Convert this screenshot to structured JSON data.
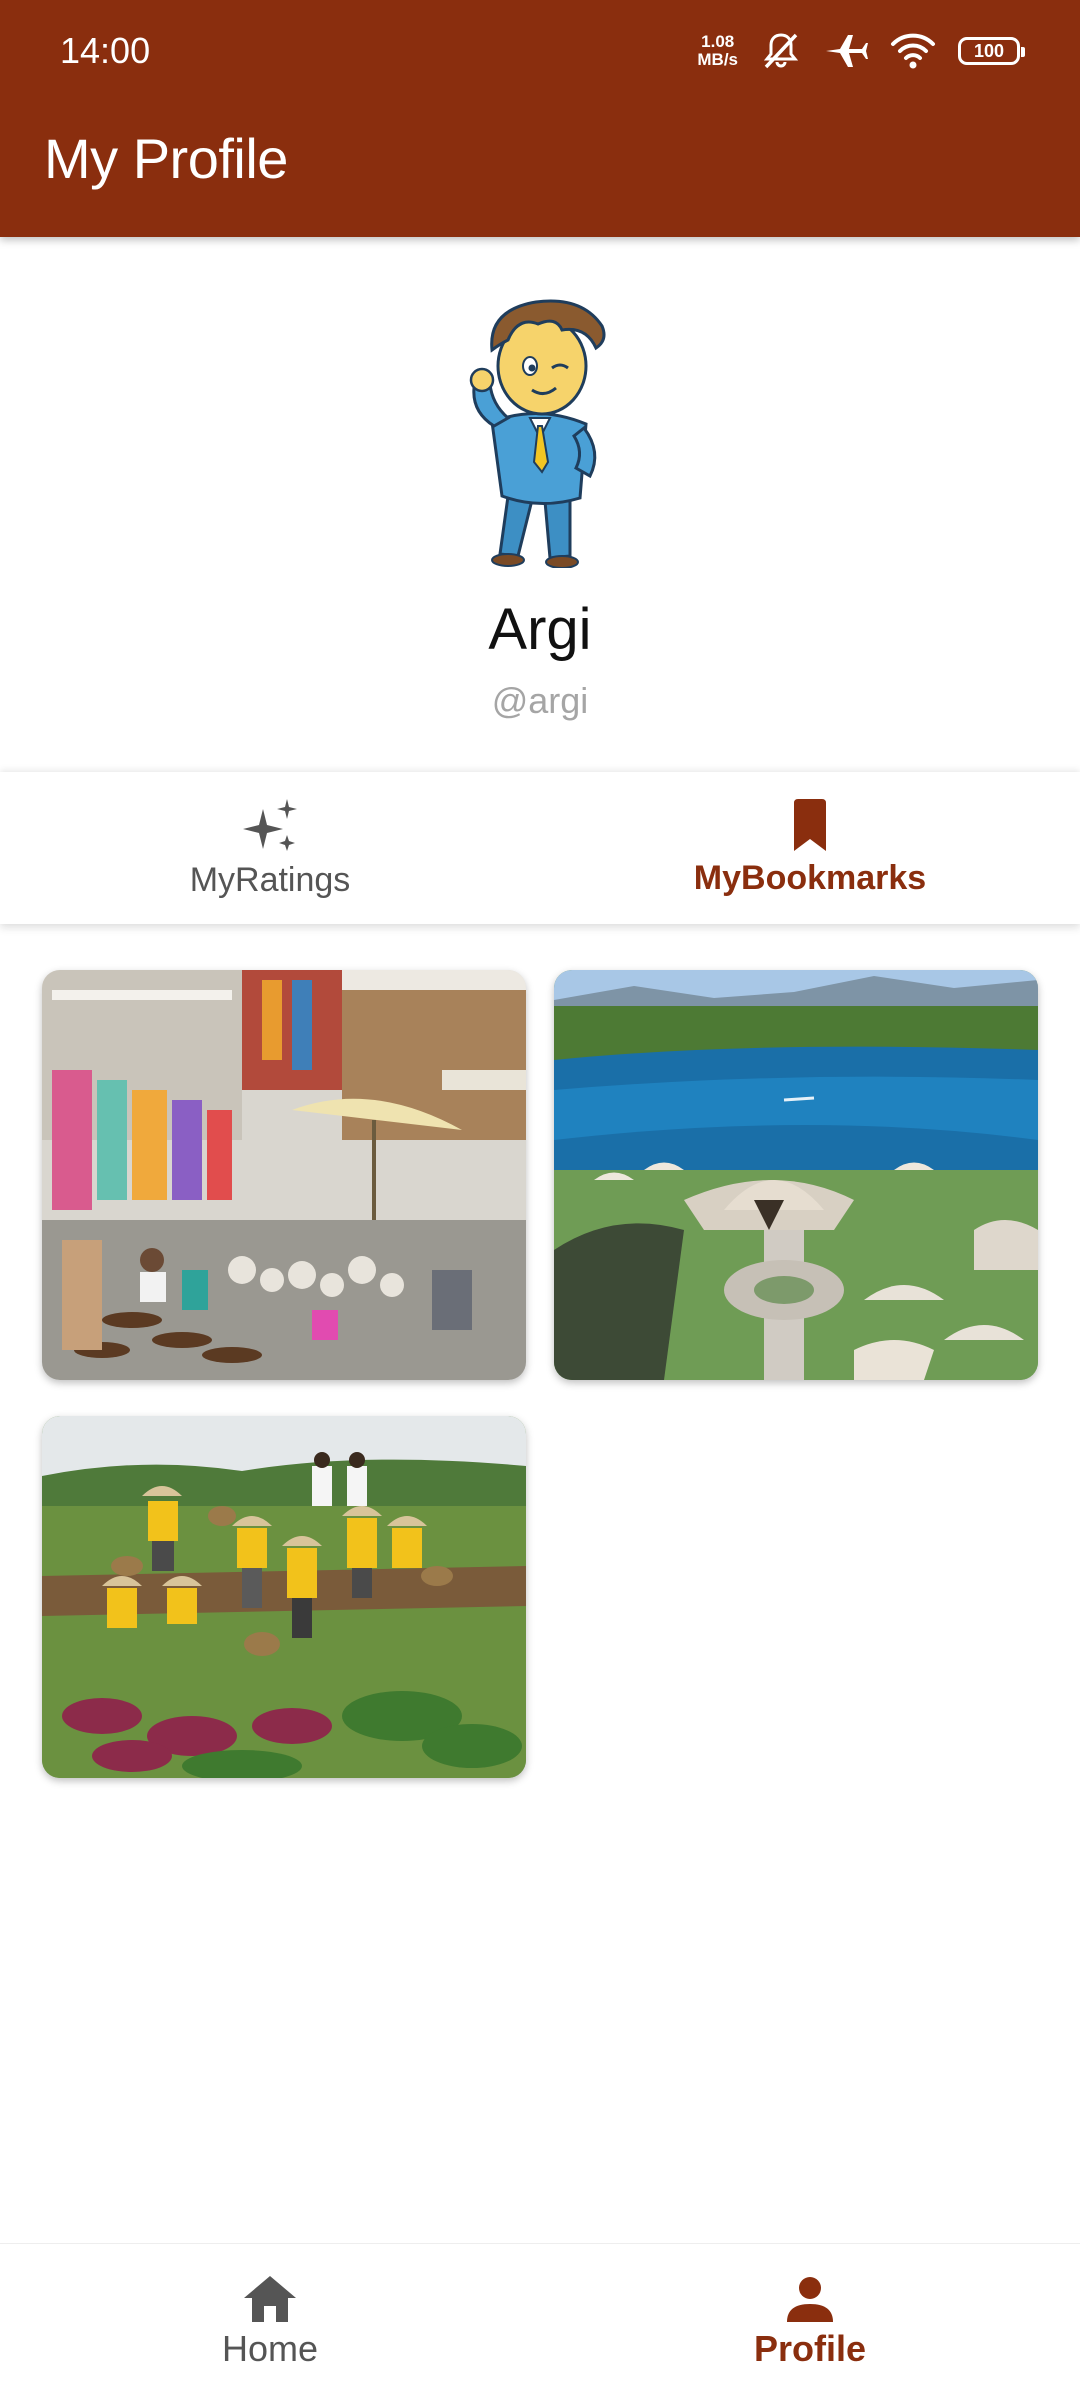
{
  "status_bar": {
    "time": "14:00",
    "net_speed_value": "1.08",
    "net_speed_unit": "MB/s",
    "battery": "100",
    "icons": [
      "net-speed-icon",
      "mute-icon",
      "airplane-mode-icon",
      "wifi-icon",
      "battery-icon"
    ]
  },
  "header": {
    "title": "My Profile"
  },
  "profile": {
    "name": "Argi",
    "handle": "@argi",
    "avatar_icon": "cartoon-avatar-icon"
  },
  "tabs": [
    {
      "label": "MyRatings",
      "icon": "sparkles-icon",
      "active": false
    },
    {
      "label": "MyBookmarks",
      "icon": "bookmark-icon",
      "active": true
    }
  ],
  "bookmarks": [
    {
      "scene": "market-stalls"
    },
    {
      "scene": "lake-resort"
    },
    {
      "scene": "farm-children"
    }
  ],
  "bottom_nav": [
    {
      "label": "Home",
      "icon": "home-icon",
      "active": false
    },
    {
      "label": "Profile",
      "icon": "person-icon",
      "active": true
    }
  ],
  "colors": {
    "primary": "#8a2e0e",
    "inactive": "#555555",
    "handle": "#a5a5a5"
  }
}
